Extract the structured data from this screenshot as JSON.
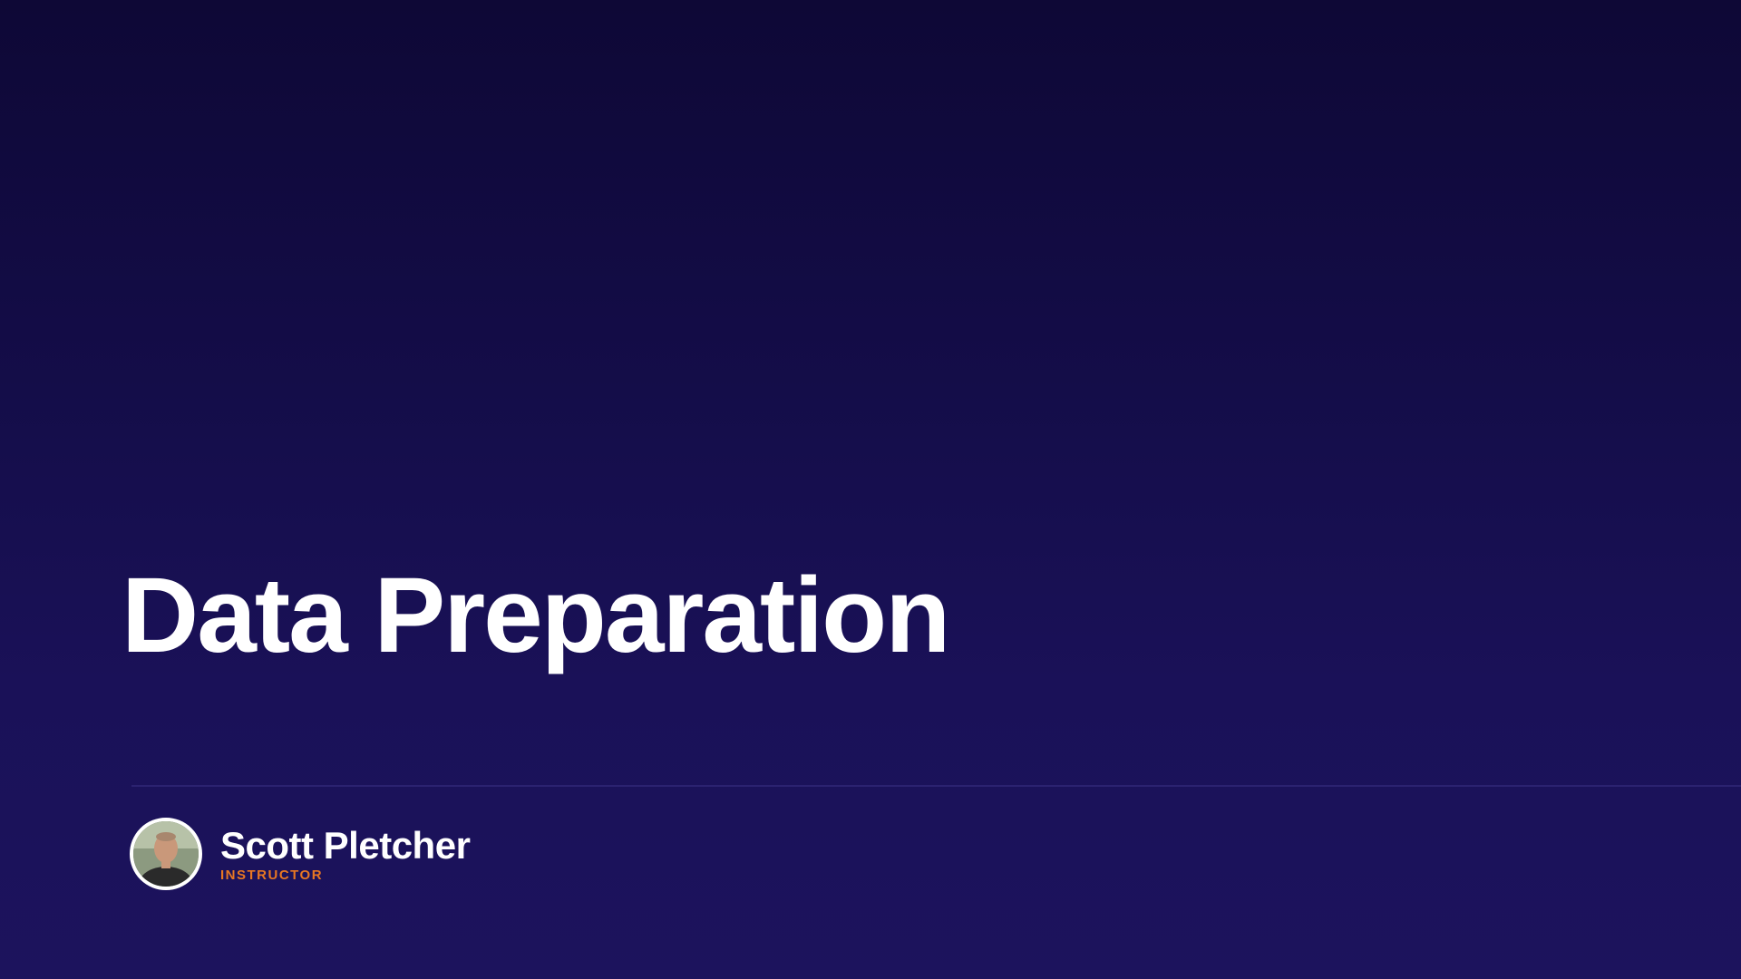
{
  "slide": {
    "title": "Data Preparation",
    "presenter": {
      "name": "Scott Pletcher",
      "role": "INSTRUCTOR",
      "avatar_icon": "person-photo-avatar"
    }
  },
  "colors": {
    "background_top": "#0e0836",
    "background_bottom": "#1c135d",
    "title": "#ffffff",
    "role_accent": "#e87722"
  }
}
